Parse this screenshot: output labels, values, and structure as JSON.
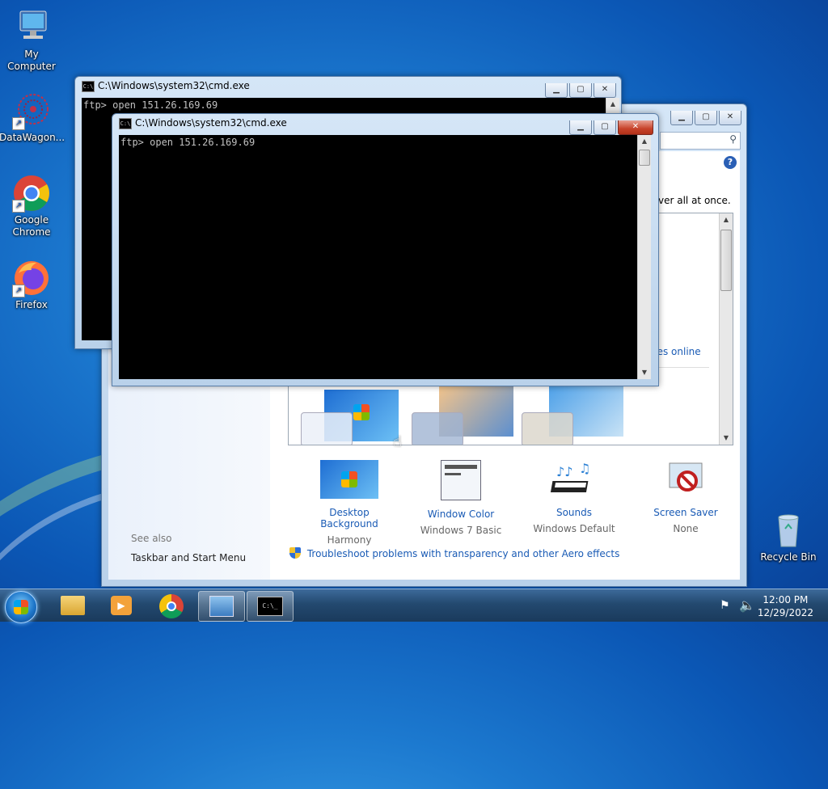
{
  "desktop": {
    "icons": [
      {
        "label": "My Computer"
      },
      {
        "label": "DataWagon..."
      },
      {
        "label": "Google Chrome"
      },
      {
        "label": "Firefox"
      },
      {
        "label": "Recycle Bin"
      }
    ]
  },
  "cmd_back": {
    "title": "C:\\Windows\\system32\\cmd.exe",
    "line": "ftp> open 151.26.169.69"
  },
  "cmd_front": {
    "title": "C:\\Windows\\system32\\cmd.exe",
    "line": "ftp> open 151.26.169.69"
  },
  "personalization": {
    "partial_text_1": "ver all at once.",
    "partial_text_2": "nes online",
    "see_also": "See also",
    "taskbar_link": "Taskbar and Start Menu",
    "tiles": [
      {
        "title": "Desktop Background",
        "sub": "Harmony"
      },
      {
        "title": "Window Color",
        "sub": "Windows 7 Basic"
      },
      {
        "title": "Sounds",
        "sub": "Windows Default"
      },
      {
        "title": "Screen Saver",
        "sub": "None"
      }
    ],
    "troubleshoot": "Troubleshoot problems with transparency and other Aero effects"
  },
  "taskbar": {
    "time": "12:00 PM",
    "date": "12/29/2022"
  },
  "colors": {
    "accent": "#1a5bb5",
    "taskbar": "#23496f"
  }
}
